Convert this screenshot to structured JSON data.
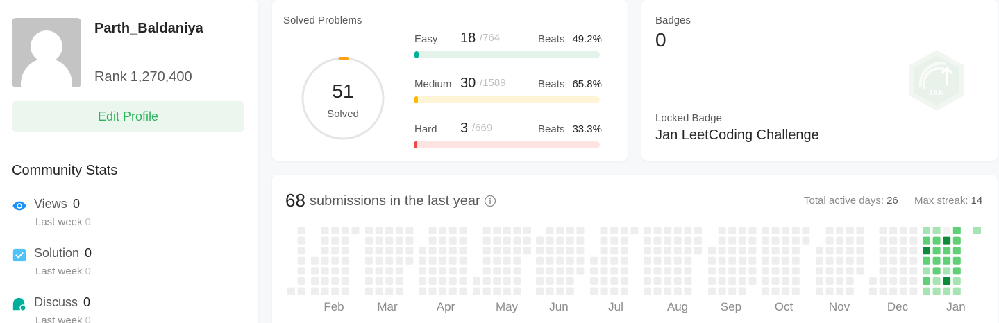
{
  "profile": {
    "username": "Parth_Baldaniya",
    "rank_label": "Rank",
    "rank_value": "1,270,400",
    "edit_button": "Edit Profile"
  },
  "community": {
    "title": "Community Stats",
    "stats": [
      {
        "label": "Views",
        "value": "0",
        "last_week_label": "Last week",
        "last_week_value": "0",
        "icon": "eye-icon",
        "color": "#1a90ff"
      },
      {
        "label": "Solution",
        "value": "0",
        "last_week_label": "Last week",
        "last_week_value": "0",
        "icon": "check-square-icon",
        "color": "#4fc3f7"
      },
      {
        "label": "Discuss",
        "value": "0",
        "last_week_label": "Last week",
        "last_week_value": "0",
        "icon": "chat-bubble-icon",
        "color": "#00af9b"
      }
    ]
  },
  "solved": {
    "title": "Solved Problems",
    "total": "51",
    "total_label": "Solved",
    "difficulties": [
      {
        "name": "Easy",
        "count": "18",
        "total": "/764",
        "beats_label": "Beats",
        "beats": "49.2%",
        "color": "#00af9b",
        "track": "#e3f3ea",
        "fraction": 0.0236
      },
      {
        "name": "Medium",
        "count": "30",
        "total": "/1589",
        "beats_label": "Beats",
        "beats": "65.8%",
        "color": "#ffb800",
        "track": "#fff4d6",
        "fraction": 0.0189
      },
      {
        "name": "Hard",
        "count": "3",
        "total": "/669",
        "beats_label": "Beats",
        "beats": "33.3%",
        "color": "#ef4743",
        "track": "#fde3e2",
        "fraction": 0.0045
      }
    ]
  },
  "badges": {
    "title": "Badges",
    "count": "0",
    "locked_title": "Locked Badge",
    "locked_name": "Jan LeetCoding Challenge",
    "badge_icon_text": "JAN"
  },
  "submissions": {
    "count": "68",
    "text": "submissions in the last year",
    "active_days_label": "Total active days:",
    "active_days": "26",
    "max_streak_label": "Max streak:",
    "max_streak": "14",
    "months": [
      "Feb",
      "Mar",
      "Apr",
      "May",
      "Jun",
      "Jul",
      "Aug",
      "Sep",
      "Oct",
      "Nov",
      "Dec",
      "Jan"
    ]
  },
  "colors": {
    "empty_cell": "#eeeeee",
    "level1": "#a6e5b3",
    "level2": "#5fd075",
    "level3": "#2db55d",
    "level4": "#0d8a3a",
    "brand_green": "#2db55d"
  }
}
